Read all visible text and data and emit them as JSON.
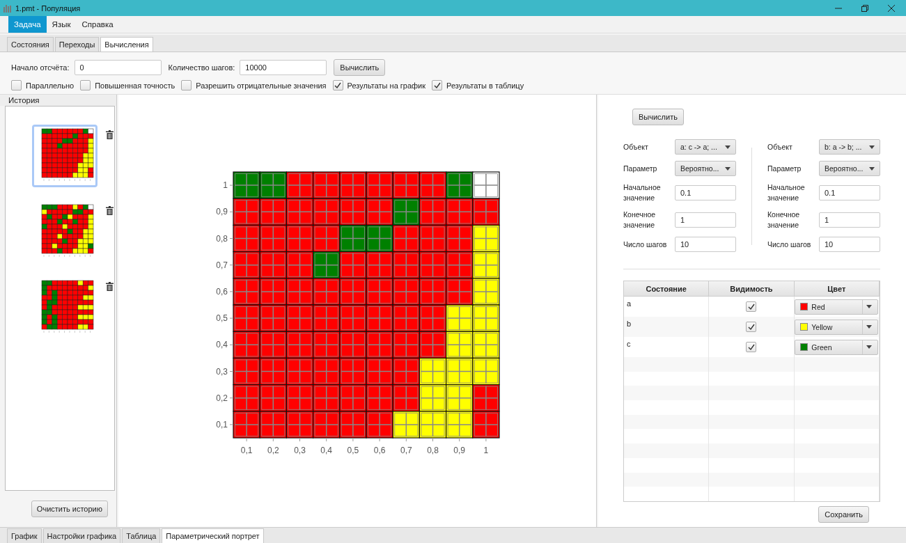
{
  "window": {
    "title": "1.pmt - Популяция"
  },
  "menu": [
    {
      "label": "Задача",
      "selected": true
    },
    {
      "label": "Язык",
      "selected": false
    },
    {
      "label": "Справка",
      "selected": false
    }
  ],
  "tabs": [
    {
      "label": "Состояния",
      "selected": false
    },
    {
      "label": "Переходы",
      "selected": false
    },
    {
      "label": "Вычисления",
      "selected": true
    }
  ],
  "toolbar": {
    "start_label": "Начало отсчёта:",
    "start_value": "0",
    "steps_label": "Количество шагов:",
    "steps_value": "10000",
    "compute_button": "Вычислить",
    "options": [
      {
        "label": "Параллельно",
        "checked": false
      },
      {
        "label": "Повышенная точность",
        "checked": false
      },
      {
        "label": "Разрешить отрицательные значения",
        "checked": false
      },
      {
        "label": "Результаты на график",
        "checked": true
      },
      {
        "label": "Результаты в таблицу",
        "checked": true
      }
    ]
  },
  "history": {
    "title": "История",
    "items": [
      {
        "selected": true
      },
      {
        "selected": false
      },
      {
        "selected": false
      }
    ],
    "clear_button": "Очистить историю"
  },
  "portrait": {
    "x_labels": [
      "0,1",
      "0,2",
      "0,3",
      "0,4",
      "0,5",
      "0,6",
      "0,7",
      "0,8",
      "0,9",
      "1"
    ],
    "y_labels": [
      "1",
      "0,9",
      "0,8",
      "0,7",
      "0,6",
      "0,5",
      "0,4",
      "0,3",
      "0,2",
      "0,1"
    ],
    "cells": [
      [
        {
          "color": "#008000"
        },
        {
          "color": "#008000"
        },
        {
          "color": "#ff0000"
        },
        {
          "color": "#ff0000"
        },
        {
          "color": "#ff0000"
        },
        {
          "color": "#ff0000"
        },
        {
          "color": "#ff0000"
        },
        {
          "color": "#ff0000"
        },
        {
          "color": "#008000"
        },
        {
          "color": "#ffffff"
        }
      ],
      [
        {
          "color": "#ff0000"
        },
        {
          "color": "#ff0000"
        },
        {
          "color": "#ff0000"
        },
        {
          "color": "#ff0000"
        },
        {
          "color": "#ff0000"
        },
        {
          "color": "#ff0000"
        },
        {
          "color": "#008000"
        },
        {
          "color": "#ff0000"
        },
        {
          "color": "#ff0000"
        },
        {
          "color": "#ff0000"
        }
      ],
      [
        {
          "color": "#ff0000"
        },
        {
          "color": "#ff0000"
        },
        {
          "color": "#ff0000"
        },
        {
          "color": "#ff0000"
        },
        {
          "color": "#008000"
        },
        {
          "color": "#008000"
        },
        {
          "color": "#ff0000"
        },
        {
          "color": "#ff0000"
        },
        {
          "color": "#ff0000"
        },
        {
          "color": "#ffff00"
        }
      ],
      [
        {
          "color": "#ff0000"
        },
        {
          "color": "#ff0000"
        },
        {
          "color": "#ff0000"
        },
        {
          "color": "#008000"
        },
        {
          "color": "#ff0000"
        },
        {
          "color": "#ff0000"
        },
        {
          "color": "#ff0000"
        },
        {
          "color": "#ff0000"
        },
        {
          "color": "#ff0000"
        },
        {
          "color": "#ffff00"
        }
      ],
      [
        {
          "color": "#ff0000"
        },
        {
          "color": "#ff0000"
        },
        {
          "color": "#ff0000"
        },
        {
          "color": "#ff0000"
        },
        {
          "color": "#ff0000"
        },
        {
          "color": "#ff0000"
        },
        {
          "color": "#ff0000"
        },
        {
          "color": "#ff0000"
        },
        {
          "color": "#ff0000"
        },
        {
          "color": "#ffff00"
        }
      ],
      [
        {
          "color": "#ff0000"
        },
        {
          "color": "#ff0000"
        },
        {
          "color": "#ff0000"
        },
        {
          "color": "#ff0000"
        },
        {
          "color": "#ff0000"
        },
        {
          "color": "#ff0000"
        },
        {
          "color": "#ff0000"
        },
        {
          "color": "#ff0000"
        },
        {
          "color": "#ffff00"
        },
        {
          "color": "#ffff00"
        }
      ],
      [
        {
          "color": "#ff0000"
        },
        {
          "color": "#ff0000"
        },
        {
          "color": "#ff0000"
        },
        {
          "color": "#ff0000"
        },
        {
          "color": "#ff0000"
        },
        {
          "color": "#ff0000"
        },
        {
          "color": "#ff0000"
        },
        {
          "color": "#ff0000"
        },
        {
          "color": "#ffff00"
        },
        {
          "color": "#ffff00"
        }
      ],
      [
        {
          "color": "#ff0000"
        },
        {
          "color": "#ff0000"
        },
        {
          "color": "#ff0000"
        },
        {
          "color": "#ff0000"
        },
        {
          "color": "#ff0000"
        },
        {
          "color": "#ff0000"
        },
        {
          "color": "#ff0000"
        },
        {
          "color": "#ffff00"
        },
        {
          "color": "#ffff00"
        },
        {
          "color": "#ffff00"
        }
      ],
      [
        {
          "color": "#ff0000"
        },
        {
          "color": "#ff0000"
        },
        {
          "color": "#ff0000"
        },
        {
          "color": "#ff0000"
        },
        {
          "color": "#ff0000"
        },
        {
          "color": "#ff0000"
        },
        {
          "color": "#ff0000"
        },
        {
          "color": "#ffff00"
        },
        {
          "color": "#ffff00"
        },
        {
          "color": "#ff0000"
        }
      ],
      [
        {
          "color": "#ff0000"
        },
        {
          "color": "#ff0000"
        },
        {
          "color": "#ff0000"
        },
        {
          "color": "#ff0000"
        },
        {
          "color": "#ff0000"
        },
        {
          "color": "#ff0000"
        },
        {
          "color": "#ffff00"
        },
        {
          "color": "#ffff00"
        },
        {
          "color": "#ffff00"
        },
        {
          "color": "#ff0000"
        }
      ]
    ]
  },
  "settings": {
    "compute_button": "Вычислить",
    "columns": [
      {
        "object_label": "Объект",
        "object_value": "a: c -> a; ...",
        "param_label": "Параметр",
        "param_value": "Вероятно...",
        "start_label": "Начальное значение",
        "start_value": "0.1",
        "end_label": "Конечное значение",
        "end_value": "1",
        "steps_label": "Число шагов",
        "steps_value": "10"
      },
      {
        "object_label": "Объект",
        "object_value": "b: a -> b; ...",
        "param_label": "Параметр",
        "param_value": "Вероятно...",
        "start_label": "Начальное значение",
        "start_value": "0.1",
        "end_label": "Конечное значение",
        "end_value": "1",
        "steps_label": "Число шагов",
        "steps_value": "10"
      }
    ]
  },
  "states_table": {
    "columns": [
      "Состояние",
      "Видимость",
      "Цвет"
    ],
    "rows": [
      {
        "state": "a",
        "visible": true,
        "color": "#ff0000",
        "color_name": "Red"
      },
      {
        "state": "b",
        "visible": true,
        "color": "#ffff00",
        "color_name": "Yellow"
      },
      {
        "state": "c",
        "visible": true,
        "color": "#008000",
        "color_name": "Green"
      }
    ]
  },
  "save_button": "Сохранить",
  "bottom_tabs": [
    {
      "label": "График",
      "selected": false
    },
    {
      "label": "Настройки графика",
      "selected": false
    },
    {
      "label": "Таблица",
      "selected": false
    },
    {
      "label": "Параметрический портрет",
      "selected": true
    }
  ]
}
